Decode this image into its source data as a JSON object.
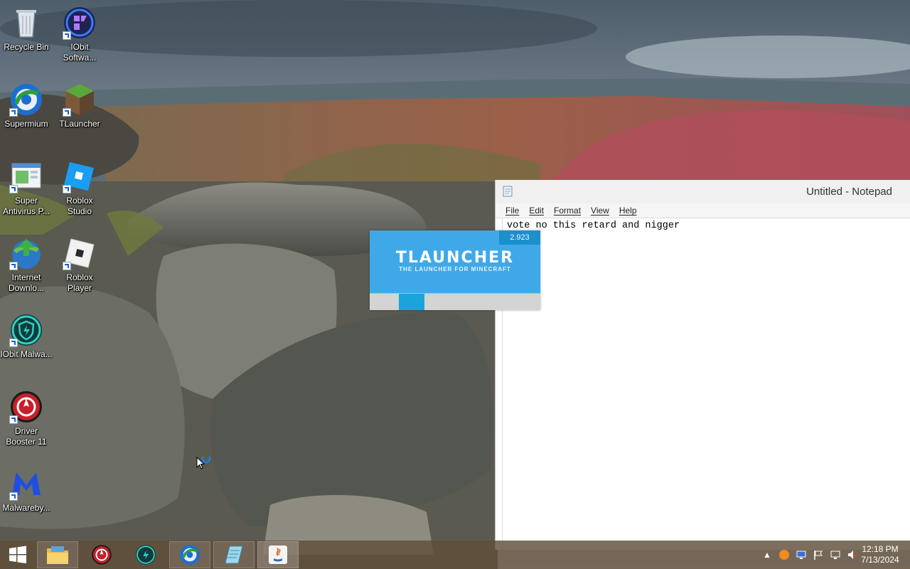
{
  "desktop": {
    "icons": [
      {
        "label": "Recycle Bin",
        "icon": "recycle-bin-icon"
      },
      {
        "label": "IObit Softwa...",
        "icon": "iobit-software-icon"
      },
      {
        "label": "Supermium",
        "icon": "supermium-icon"
      },
      {
        "label": "TLauncher",
        "icon": "tlauncher-icon"
      },
      {
        "label": "Super Antivirus P...",
        "icon": "super-antivirus-icon"
      },
      {
        "label": "Roblox Studio",
        "icon": "roblox-studio-icon"
      },
      {
        "label": "Internet Downlo...",
        "icon": "internet-download-manager-icon"
      },
      {
        "label": "Roblox Player",
        "icon": "roblox-player-icon"
      },
      {
        "label": "IObit Malwa...",
        "icon": "iobit-malware-fighter-icon"
      },
      {
        "label": "Driver Booster 11",
        "icon": "driver-booster-icon"
      },
      {
        "label": "Malwareby...",
        "icon": "malwarebytes-icon"
      }
    ]
  },
  "notepad": {
    "title": "Untitled - Notepad",
    "menu": [
      "File",
      "Edit",
      "Format",
      "View",
      "Help"
    ],
    "content": "vote no this retard and nigger"
  },
  "splash": {
    "version": "2.923",
    "brand": "TLAUNCHER",
    "tagline": "THE LAUNCHER FOR MINECRAFT",
    "progress": 0.15,
    "progress_start": 0.17
  },
  "taskbar": {
    "apps": [
      "start-icon",
      "file-explorer-icon",
      "driver-booster-icon",
      "iobit-malware-fighter-icon",
      "supermium-icon",
      "notepad-icon",
      "java-icon"
    ],
    "clock": {
      "time": "12:18 PM",
      "date": "7/13/2024"
    }
  },
  "colors": {
    "taskbar": "#604e3a",
    "splash": "#3fa9e8",
    "splash_bar": "#1aa4d8"
  }
}
